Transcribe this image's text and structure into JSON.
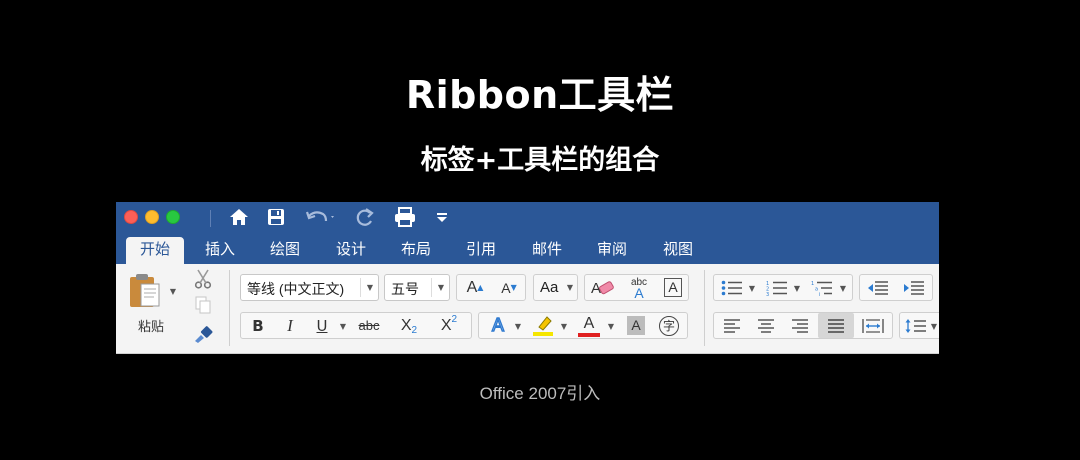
{
  "heading": {
    "title": "Ribbon工具栏",
    "subtitle": "标签+工具栏的组合",
    "caption": "Office 2007引入"
  },
  "window": {
    "colors": {
      "titlebar": "#2b5797",
      "ribbon": "#f4f4f4",
      "accent": "#2b5797"
    },
    "quick_access": [
      "home-icon",
      "save-icon",
      "undo-icon",
      "redo-icon",
      "print-icon",
      "customize-icon"
    ]
  },
  "tabs": [
    {
      "label": "开始",
      "active": true
    },
    {
      "label": "插入",
      "active": false
    },
    {
      "label": "绘图",
      "active": false
    },
    {
      "label": "设计",
      "active": false
    },
    {
      "label": "布局",
      "active": false
    },
    {
      "label": "引用",
      "active": false
    },
    {
      "label": "邮件",
      "active": false
    },
    {
      "label": "审阅",
      "active": false
    },
    {
      "label": "视图",
      "active": false
    }
  ],
  "clipboard": {
    "paste_label": "粘贴"
  },
  "font": {
    "family": "等线 (中文正文)",
    "size": "五号",
    "bold": "B",
    "italic": "I",
    "underline": "U",
    "strike": "abc",
    "subscript_base": "X",
    "subscript_mark": "2",
    "superscript_base": "X",
    "superscript_mark": "2",
    "grow": "A",
    "shrink": "A",
    "case": "Aa",
    "phonetic_top": "abc",
    "phonetic_bottom": "A",
    "border_char": "A",
    "effect": "A",
    "color_char": "A",
    "shade_char": "A",
    "enclose_char": "字",
    "colors": {
      "highlight": "#f5e600",
      "font_color": "#e02020",
      "effect": "#2f7ad0"
    }
  }
}
